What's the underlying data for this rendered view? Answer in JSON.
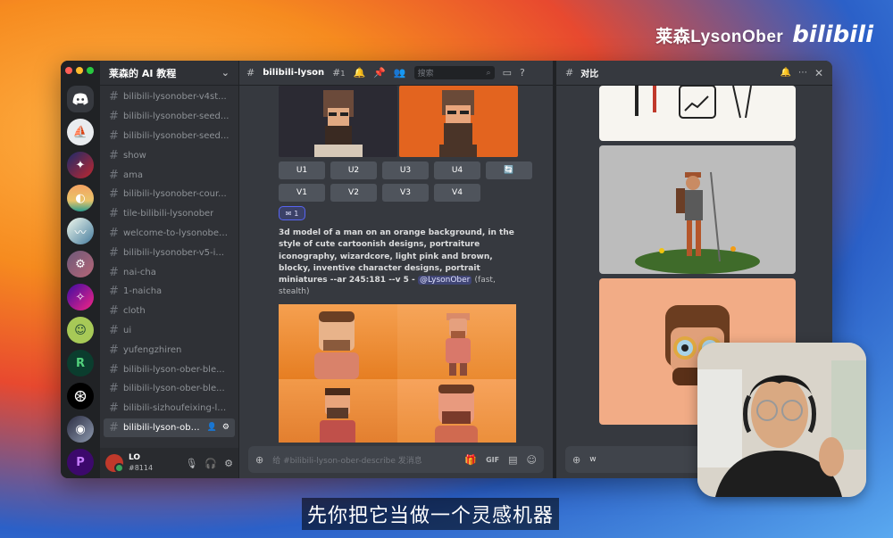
{
  "watermark": {
    "name": "莱森LysonOber",
    "logo": "bilibili"
  },
  "subtitle": "先你把它当做一个灵感机器",
  "colors": {
    "accent": "#5865f2",
    "rail": "#202225",
    "sidebar": "#2f3136",
    "chat": "#36393f",
    "button": "#4f545c"
  },
  "servers": [
    "discord",
    "sailboat",
    "ai-art",
    "beach",
    "wave",
    "mech",
    "neon",
    "frog",
    "r-logo",
    "openai",
    "ai-tag",
    "p-logo",
    "ac-logo"
  ],
  "sidebar": {
    "guild_name": "莱森的 AI 教程",
    "channels": [
      "bilibili-lysonober-v4st...",
      "bilibili-lysonober-seed...",
      "bilibili-lysonober-seed...",
      "show",
      "ama",
      "bilibili-lysonober-cour...",
      "tile-bilibili-lysonober",
      "welcome-to-lysonober...",
      "bilibili-lysonober-v5-i...",
      "nai-cha",
      "1-naicha",
      "cloth",
      "ui",
      "yufengzhiren",
      "bilibili-lyson-ober-ble...",
      "bilibili-lyson-ober-ble...",
      "bilibili-sizhoufeixing-ly..."
    ],
    "active_channel": "bilibili-lyson-ober-...",
    "user": {
      "name": "LO",
      "tag": "#8114"
    }
  },
  "chat": {
    "channel_title": "bilibili-lyson",
    "thread_count": "1",
    "search_placeholder": "搜索",
    "upscale_buttons": [
      "U1",
      "U2",
      "U3",
      "U4"
    ],
    "variation_buttons": [
      "V1",
      "V2",
      "V3",
      "V4"
    ],
    "reaction_count": "1",
    "prompt_text": "3d model of a man on an orange background, in the style of cute cartoonish designs, portraiture iconography, wizardcore, light pink and brown, blocky, inventive character designs, portrait miniatures --ar 245:181 --v 5 -",
    "mention": "@LysonOber",
    "meta": "(fast, stealth)",
    "composer_placeholder": "给 #bilibili-lyson-ober-describe 发消息"
  },
  "thread": {
    "title": "对比",
    "composer_value": "w"
  }
}
